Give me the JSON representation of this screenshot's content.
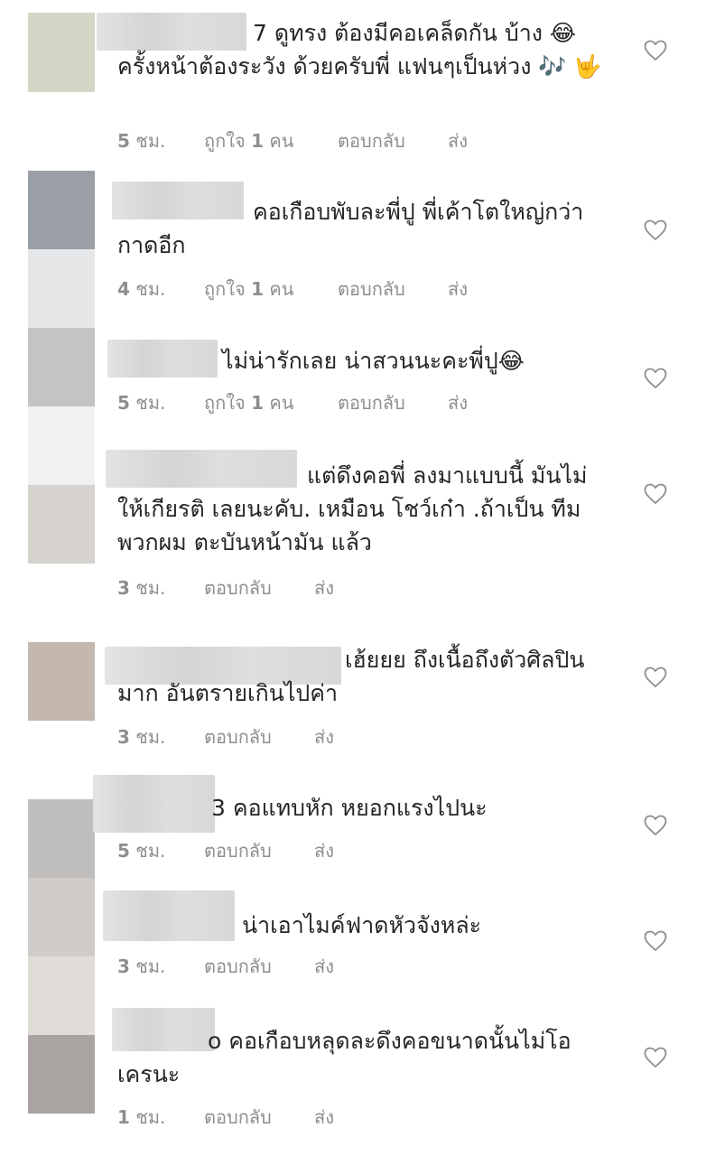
{
  "avatar_colors": [
    "#d3d8c6",
    "#9aa0a6",
    "#e6e7e8",
    "#c5c3c3",
    "#f1f1f1",
    "#d6d3cf",
    "#c4b7ae",
    "#c0bdbd",
    "#d0ccc9",
    "#e0ddd9",
    "#a9a4a2"
  ],
  "comments": [
    {
      "text": "7 ดูทรง ต้องมีคอเคล็ดกัน บ้าง 😂 ครั้งหน้าต้องระวัง ด้วยครับพี่ แฟนๆเป็นห่วง 🎶 🤟",
      "time_num": "5",
      "time_unit": "ชม.",
      "likes_label": "ถูกใจ",
      "likes_num": "1",
      "likes_unit": "คน",
      "reply": "ตอบกลับ",
      "send": "ส่ง"
    },
    {
      "text": "คอเกือบพับละพี่ปู พี่เค้าโตใหญ่กว่ากาดอีก",
      "time_num": "4",
      "time_unit": "ชม.",
      "likes_label": "ถูกใจ",
      "likes_num": "1",
      "likes_unit": "คน",
      "reply": "ตอบกลับ",
      "send": "ส่ง"
    },
    {
      "text": "ไม่น่ารักเลย น่าสวนนะคะพี่ปู😂",
      "time_num": "5",
      "time_unit": "ชม.",
      "likes_label": "ถูกใจ",
      "likes_num": "1",
      "likes_unit": "คน",
      "reply": "ตอบกลับ",
      "send": "ส่ง"
    },
    {
      "text": "แต่ดึงคอพี่ ลงมาแบบนี้ มันไม่ให้เกียรติ เลยนะคับ. เหมือน โชว์เก๋า .ถ้าเป็น ทีมพวกผม ตะบันหน้ามัน แล้ว",
      "time_num": "3",
      "time_unit": "ชม.",
      "reply": "ตอบกลับ",
      "send": "ส่ง"
    },
    {
      "text": "เฮ้ยยย ถึงเนื้อถึงตัวศิลปินมาก อันตรายเกินไปค่า",
      "time_num": "3",
      "time_unit": "ชม.",
      "reply": "ตอบกลับ",
      "send": "ส่ง"
    },
    {
      "text": "3 คอแทบหัก หยอกแรงไปนะ",
      "time_num": "5",
      "time_unit": "ชม.",
      "reply": "ตอบกลับ",
      "send": "ส่ง"
    },
    {
      "text": "น่าเอาไมค์ฟาดหัวจังหล่ะ",
      "time_num": "3",
      "time_unit": "ชม.",
      "reply": "ตอบกลับ",
      "send": "ส่ง"
    },
    {
      "text": "o คอเกือบหลุดละดึงคอขนาดนั้นไม่โอเครนะ",
      "time_num": "1",
      "time_unit": "ชม.",
      "reply": "ตอบกลับ",
      "send": "ส่ง"
    }
  ]
}
